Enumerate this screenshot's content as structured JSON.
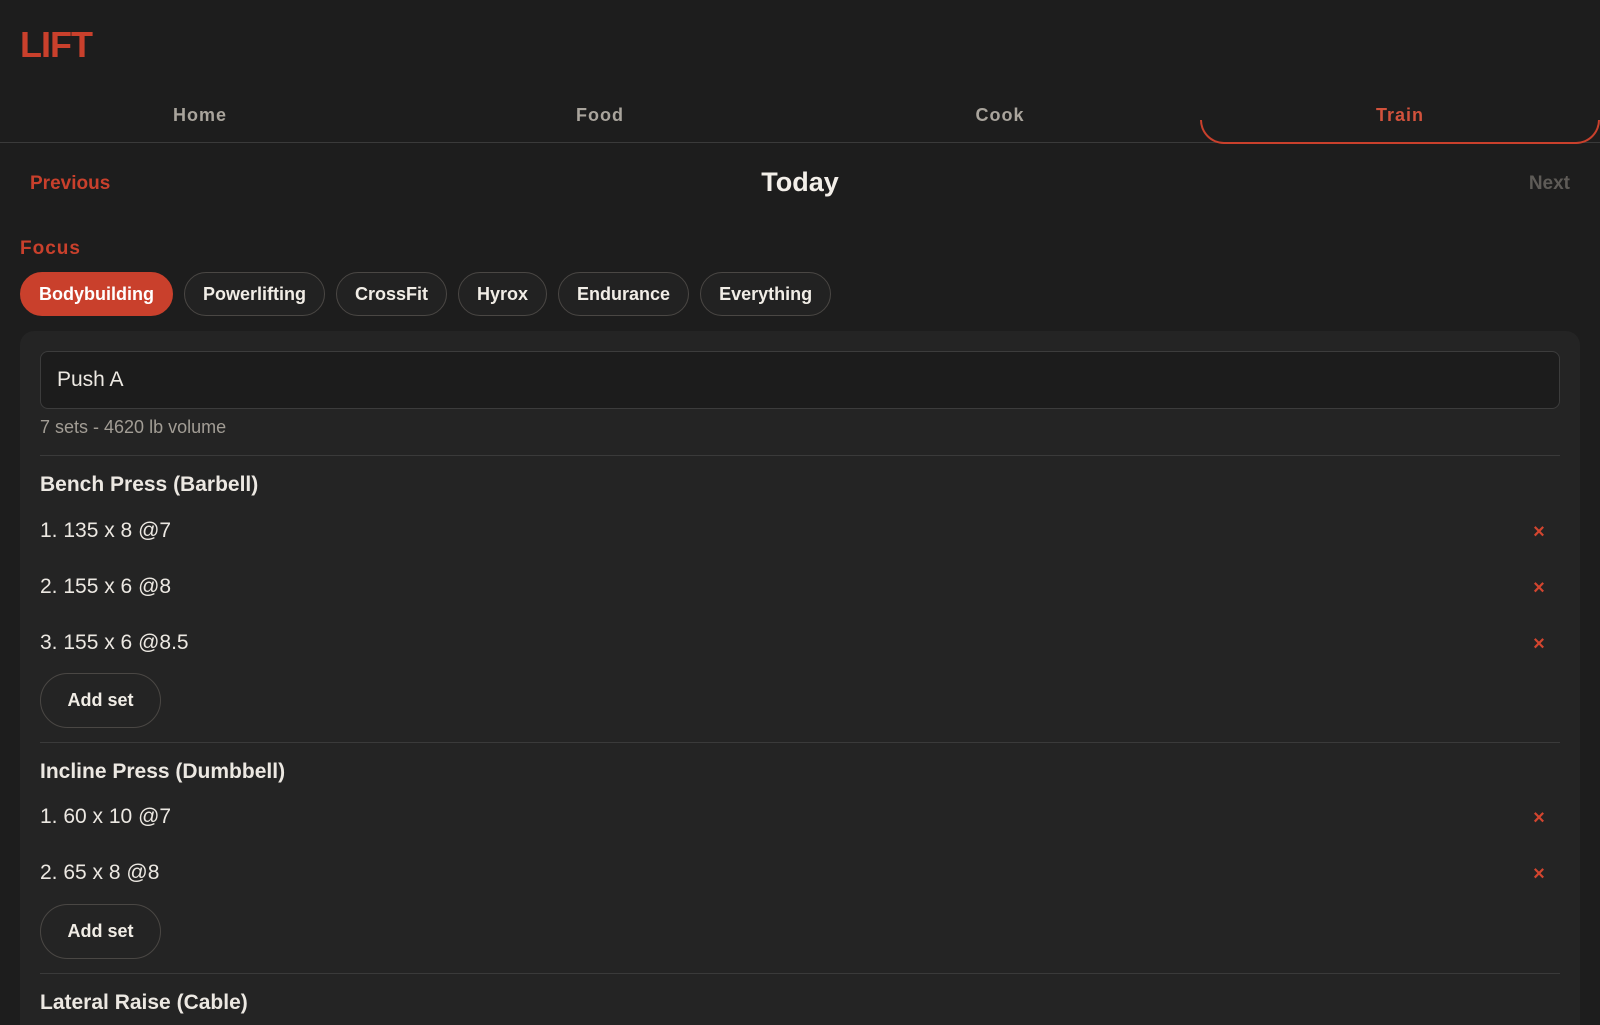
{
  "app": {
    "logo": "LIFT"
  },
  "nav": {
    "tabs": [
      "Home",
      "Food",
      "Cook",
      "Train"
    ],
    "active": "Train"
  },
  "day": {
    "previous": "Previous",
    "title": "Today",
    "next": "Next"
  },
  "focus": {
    "label": "Focus",
    "options": [
      "Bodybuilding",
      "Powerlifting",
      "CrossFit",
      "Hyrox",
      "Endurance",
      "Everything"
    ],
    "selected": "Bodybuilding"
  },
  "workout": {
    "name": "Push A",
    "summary": "7 sets - 4620 lb volume",
    "add_set_label": "Add set",
    "delete_icon": "×",
    "exercises": [
      {
        "name": "Bench Press (Barbell)",
        "sets": [
          "1. 135 x 8 @7",
          "2. 155 x 6 @8",
          "3. 155 x 6 @8.5"
        ]
      },
      {
        "name": "Incline Press (Dumbbell)",
        "sets": [
          "1. 60 x 10 @7",
          "2. 65 x 8 @8"
        ]
      },
      {
        "name": "Lateral Raise (Cable)",
        "sets": []
      }
    ]
  },
  "colors": {
    "accent": "#c9402c",
    "background": "#1d1d1d",
    "card": "#242424"
  }
}
